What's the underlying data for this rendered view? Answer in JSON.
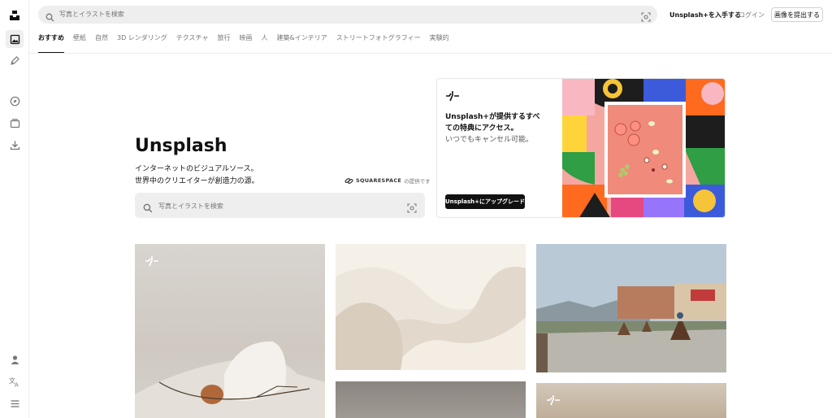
{
  "header": {
    "search_placeholder": "写真とイラストを検索",
    "get_plus": "Unsplash+を入手する",
    "login": "ログイン",
    "submit_image": "画像を提出する"
  },
  "categories": [
    {
      "label": "おすすめ",
      "active": true
    },
    {
      "label": "壁紙"
    },
    {
      "label": "自然"
    },
    {
      "label": "3D レンダリング"
    },
    {
      "label": "テクスチャ"
    },
    {
      "label": "旅行"
    },
    {
      "label": "映画"
    },
    {
      "label": "人"
    },
    {
      "label": "建築&インテリア"
    },
    {
      "label": "ストリートフォトグラフィー"
    },
    {
      "label": "実験的"
    }
  ],
  "hero": {
    "title": "Unsplash",
    "subtitle_line1": "インターネットのビジュアルソース。",
    "subtitle_line2": "世界中のクリエイターが創造力の源。",
    "sponsor_logo": "SQUARESPACE",
    "sponsor_suffix": "の提供です",
    "search_placeholder": "写真とイラストを検索"
  },
  "promo": {
    "line1": "Unsplash+が提供するすべ",
    "line2": "ての特典にアクセス。",
    "line3": "いつでもキャンセル可能。",
    "button": "Unsplash+にアップグレード"
  },
  "icons": {
    "logo": "unsplash-logo",
    "rail": [
      "home-icon",
      "pen-icon",
      "compass-icon",
      "collections-icon",
      "download-icon",
      "user-icon",
      "translate-icon",
      "menu-icon"
    ],
    "search": "search-icon",
    "visual_search": "visual-search-icon",
    "plus": "unsplash-plus-icon"
  },
  "colors": {
    "accent_dark": "#111111",
    "muted_text": "#767676",
    "search_bg": "#eeeeee"
  }
}
